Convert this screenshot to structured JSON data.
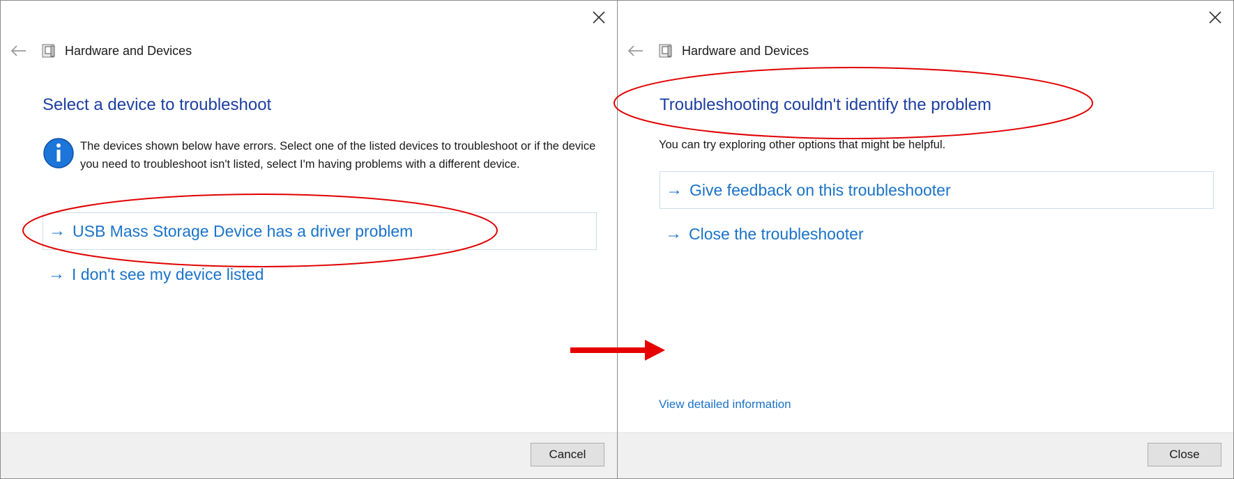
{
  "accent_color": "#1a73c8",
  "heading_color": "#1d3fa0",
  "annotation_color": "#e00000",
  "left_window": {
    "title": "Hardware and Devices",
    "heading": "Select a device to troubleshoot",
    "info_text": "The devices shown below have errors. Select one of the listed devices to troubleshoot or if the device you need to troubleshoot isn't listed, select I'm having problems with a different device.",
    "options": [
      {
        "arrow": "→",
        "label": "USB Mass Storage Device has a driver problem"
      },
      {
        "arrow": "→",
        "label": "I don't see my device listed"
      }
    ],
    "button": "Cancel"
  },
  "right_window": {
    "title": "Hardware and Devices",
    "heading": "Troubleshooting couldn't identify the problem",
    "subtext": "You can try exploring other options that might be helpful.",
    "options": [
      {
        "arrow": "→",
        "label": "Give feedback on this troubleshooter"
      },
      {
        "arrow": "→",
        "label": "Close the troubleshooter"
      }
    ],
    "detail_link": "View detailed information",
    "button": "Close"
  }
}
